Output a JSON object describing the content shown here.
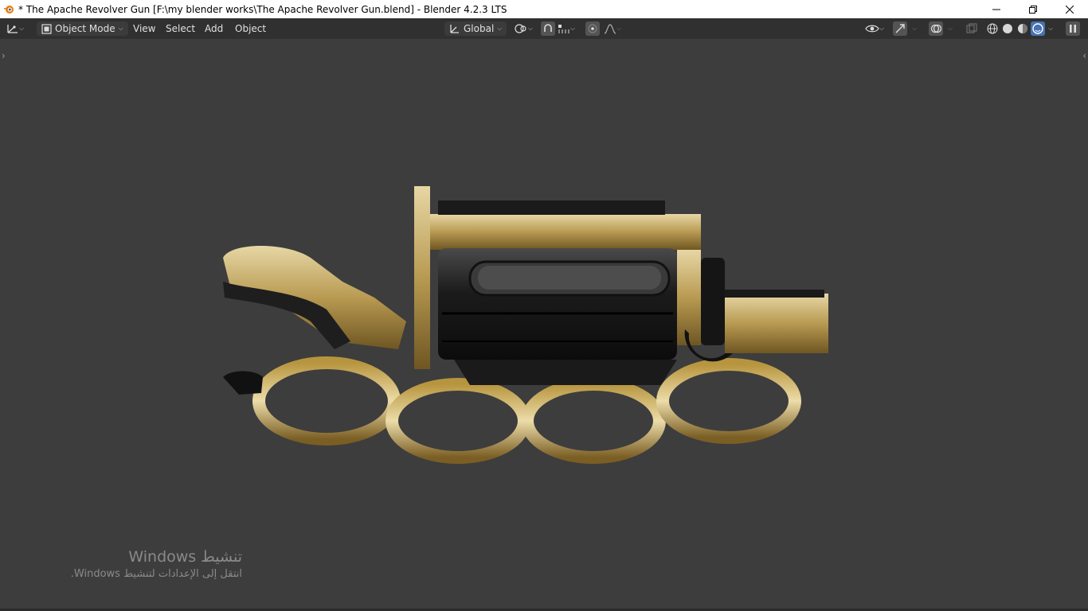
{
  "window": {
    "title": "* The Apache Revolver Gun [F:\\my blender works\\The Apache Revolver Gun.blend] - Blender 4.2.3 LTS",
    "minimize_icon": "minimize-icon",
    "restore_icon": "restore-icon",
    "close_icon": "close-icon"
  },
  "header": {
    "editor_type_icon": "editor-type-icon",
    "mode_label": "Object Mode",
    "menus": [
      "View",
      "Select",
      "Add",
      "Object"
    ],
    "orientation_label": "Global",
    "icons": {
      "pivot": "pivot-icon",
      "snap": "snap-icon",
      "snap_increment": "snap-increment-icon",
      "proportional": "proportional-edit-icon",
      "falloff": "falloff-icon",
      "visibility": "eye-icon",
      "gizmo": "gizmo-icon",
      "overlay": "overlay-icon",
      "xray": "xray-icon",
      "shading_wireframe": "wireframe-shading-icon",
      "shading_solid": "solid-shading-icon",
      "shading_material": "material-shading-icon",
      "shading_rendered": "rendered-shading-icon",
      "pause": "pause-icon"
    },
    "colors": {
      "accent": "#4772b3",
      "header_bg": "#303030",
      "viewport_bg": "#3d3d3d"
    }
  },
  "watermark": {
    "title": "تنشيط Windows",
    "subtitle": "انتقل إلى الإعدادات لتنشيط Windows."
  }
}
